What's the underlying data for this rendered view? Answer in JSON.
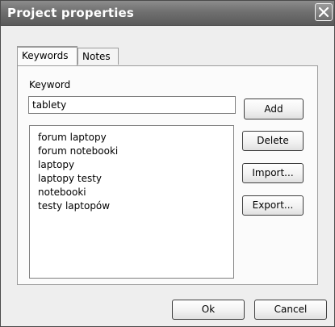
{
  "window": {
    "title": "Project properties"
  },
  "tabs": [
    {
      "label": "Keywords",
      "active": true
    },
    {
      "label": "Notes",
      "active": false
    }
  ],
  "keywords_panel": {
    "keyword_label": "Keyword",
    "keyword_value": "tablety",
    "items": [
      "forum laptopy",
      "forum notebooki",
      "laptopy",
      "laptopy testy",
      "notebooki",
      "testy laptopów"
    ],
    "buttons": {
      "add": "Add",
      "delete": "Delete",
      "import": "Import...",
      "export": "Export..."
    }
  },
  "footer": {
    "ok": "Ok",
    "cancel": "Cancel"
  },
  "icons": {
    "close": "close-icon"
  },
  "colors": {
    "titlebar": "#707070",
    "title_text": "#ffffff",
    "dialog_bg": "#eeeeee"
  }
}
